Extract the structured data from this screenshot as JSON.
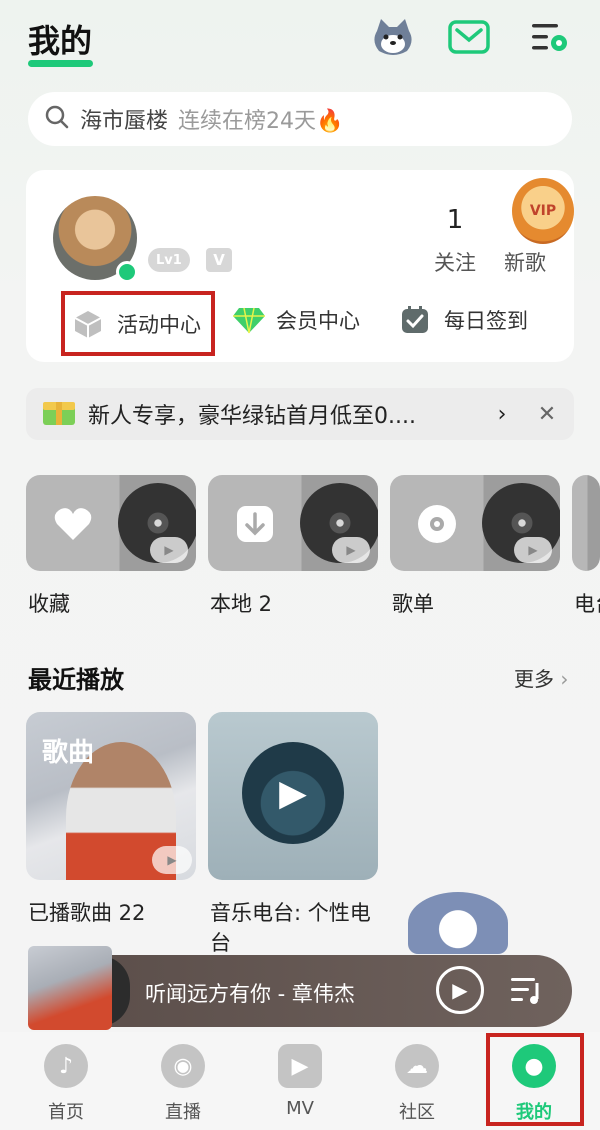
{
  "header": {
    "title": "我的",
    "icons": [
      "mascot-avatar-icon",
      "mail-icon",
      "menu-settings-icon"
    ]
  },
  "search": {
    "text": "海市蜃楼",
    "hint": "连续在榜24天🔥"
  },
  "profile": {
    "level": "Lv1",
    "stats": [
      {
        "num": "1",
        "label": "关注"
      },
      {
        "num": "",
        "label": "新歌"
      }
    ],
    "vip_badge": "VIP",
    "quick_actions": [
      {
        "label": "活动中心",
        "icon": "cube-icon"
      },
      {
        "label": "会员中心",
        "icon": "diamond-icon"
      },
      {
        "label": "每日签到",
        "icon": "calendar-check-icon"
      }
    ]
  },
  "promo": {
    "text": "新人专享，豪华绿钻首月低至0....",
    "arrow": "›",
    "close": "✕"
  },
  "tiles": [
    {
      "label": "收藏",
      "icon": "heart-icon"
    },
    {
      "label": "本地 2",
      "icon": "download-icon"
    },
    {
      "label": "歌单",
      "icon": "disc-icon"
    },
    {
      "label": "电台",
      "icon": "radio-icon"
    }
  ],
  "recent": {
    "title": "最近播放",
    "more": "更多",
    "items": [
      {
        "cover_label": "歌曲",
        "caption": "已播歌曲 22"
      },
      {
        "cover_label": "",
        "caption": "音乐电台: 个性电台"
      }
    ]
  },
  "player": {
    "now_playing": "听闻远方有你 - 章伟杰"
  },
  "nav": [
    {
      "label": "首页",
      "icon": "home-note-icon"
    },
    {
      "label": "直播",
      "icon": "eye-icon"
    },
    {
      "label": "MV",
      "icon": "video-play-icon"
    },
    {
      "label": "社区",
      "icon": "community-icon"
    },
    {
      "label": "我的",
      "icon": "user-icon",
      "active": true
    }
  ],
  "colors": {
    "accent": "#1ec97a",
    "highlight": "#c8241f"
  }
}
